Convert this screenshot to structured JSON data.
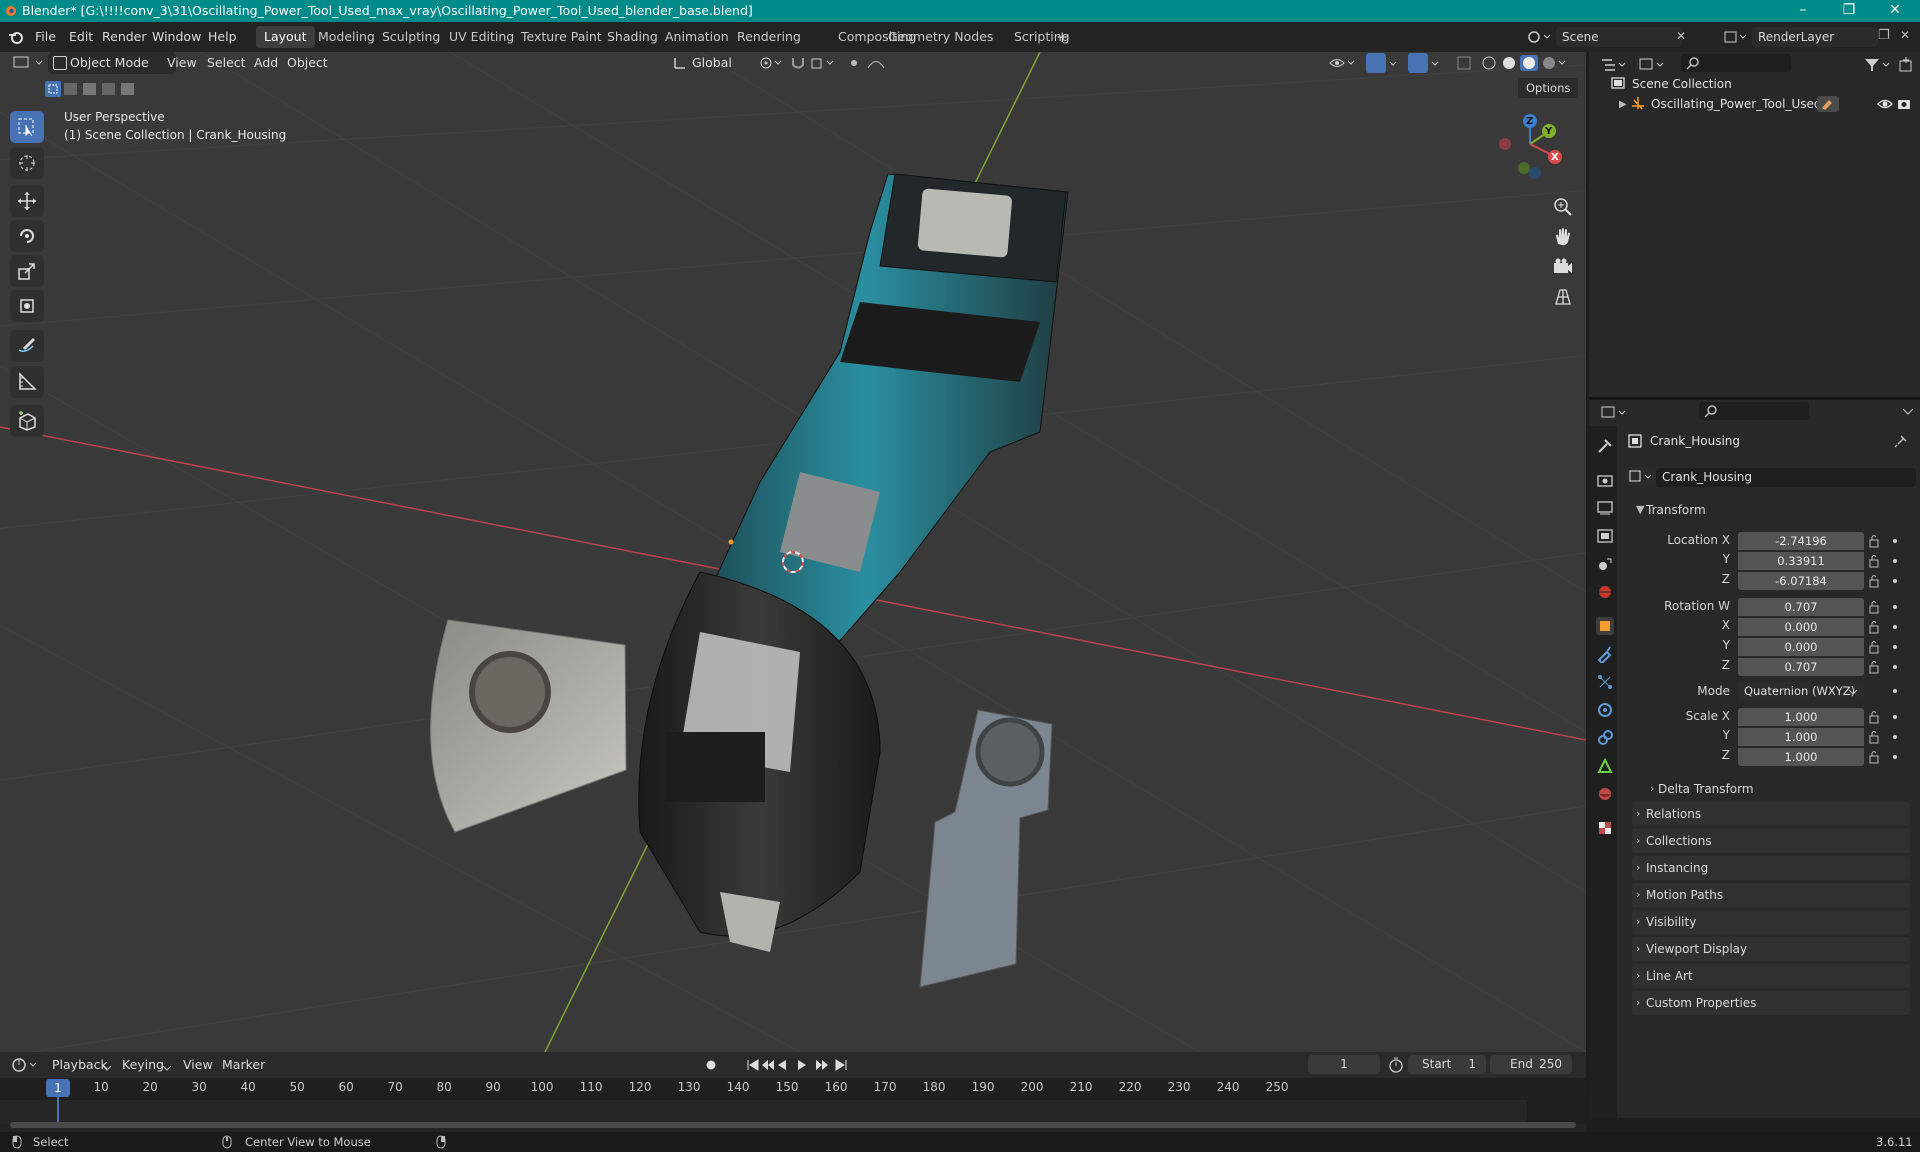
{
  "window": {
    "title": "Blender* [G:\\!!!!conv_3\\31\\Oscillating_Power_Tool_Used_max_vray\\Oscillating_Power_Tool_Used_blender_base.blend]",
    "controls": [
      "–",
      "❐",
      "✕"
    ]
  },
  "menu": {
    "items": [
      "File",
      "Edit",
      "Render",
      "Window",
      "Help"
    ],
    "workspaces": [
      "Layout",
      "Modeling",
      "Sculpting",
      "UV Editing",
      "Texture Paint",
      "Shading",
      "Animation",
      "Rendering",
      "Compositing",
      "Geometry Nodes",
      "Scripting"
    ],
    "add_tab": "+",
    "scene_name": "Scene",
    "render_layer": "RenderLayer"
  },
  "viewport": {
    "mode": "Object Mode",
    "menus": [
      "View",
      "Select",
      "Add",
      "Object"
    ],
    "orientation": "Global",
    "options_label": "Options",
    "view_name": "User Perspective",
    "view_context": "(1) Scene Collection | Crank_Housing",
    "gizmo_labels": {
      "x": "X",
      "y": "Y",
      "z": "Z"
    }
  },
  "outliner": {
    "root": "Scene Collection",
    "items": [
      {
        "label": "Oscillating_Power_Tool_Used"
      }
    ]
  },
  "properties": {
    "object_name": "Crank_Housing",
    "data_name": "Crank_Housing",
    "transform_title": "Transform",
    "location": {
      "label": "Location X",
      "x": "-2.74196",
      "y": "0.33911",
      "z": "-6.07184"
    },
    "rotation": {
      "label": "Rotation W",
      "w": "0.707",
      "x": "0.000",
      "y": "0.000",
      "z": "0.707"
    },
    "mode_label": "Mode",
    "mode_value": "Quaternion (WXYZ)",
    "scale": {
      "label": "Scale X",
      "x": "1.000",
      "y": "1.000",
      "z": "1.000"
    },
    "axis_labels": {
      "x": "X",
      "y": "Y",
      "z": "Z"
    },
    "delta_transform": "Delta Transform",
    "panels": [
      "Relations",
      "Collections",
      "Instancing",
      "Motion Paths",
      "Visibility",
      "Viewport Display",
      "Line Art",
      "Custom Properties"
    ]
  },
  "timeline": {
    "menus": [
      "Playback",
      "Keying",
      "View",
      "Marker"
    ],
    "current_frame": "1",
    "start_label": "Start",
    "start": "1",
    "end_label": "End",
    "end": "250",
    "ticks": [
      "1",
      "10",
      "20",
      "30",
      "40",
      "50",
      "60",
      "70",
      "80",
      "90",
      "100",
      "110",
      "120",
      "130",
      "140",
      "150",
      "160",
      "170",
      "180",
      "190",
      "200",
      "210",
      "220",
      "230",
      "240",
      "250"
    ]
  },
  "status": {
    "select": "Select",
    "center": "Center View to Mouse",
    "version": "3.6.11"
  },
  "colors": {
    "accent": "#4772b3",
    "titlebar": "#008b8b",
    "tool_teal": "#2a8fa0",
    "x_axis": "#d94a4a",
    "y_axis": "#7fb030",
    "z_axis": "#3a80d0"
  }
}
